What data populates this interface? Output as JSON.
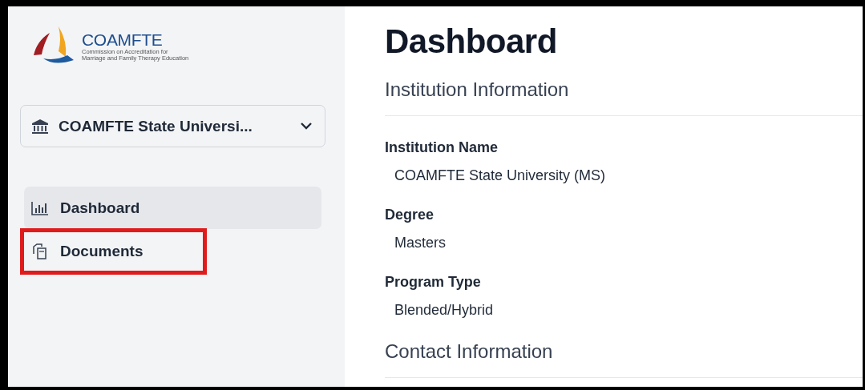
{
  "logo": {
    "name": "COAMFTE",
    "tagline": [
      "Commission on Accreditation for",
      "Marriage and Family Therapy Education"
    ]
  },
  "institution_selector": {
    "value": "COAMFTE State Universi...",
    "expanded": false
  },
  "nav": [
    {
      "label": "Dashboard",
      "kind": "chart",
      "selected": true,
      "highlighted": false
    },
    {
      "label": "Documents",
      "kind": "documents",
      "selected": false,
      "highlighted": true
    }
  ],
  "page_title": "Dashboard",
  "sections": [
    {
      "title": "Institution Information",
      "fields": [
        {
          "label": "Institution Name",
          "value": "COAMFTE State University (MS)"
        },
        {
          "label": "Degree",
          "value": "Masters"
        },
        {
          "label": "Program Type",
          "value": "Blended/Hybrid"
        }
      ]
    },
    {
      "title": "Contact Information"
    }
  ]
}
